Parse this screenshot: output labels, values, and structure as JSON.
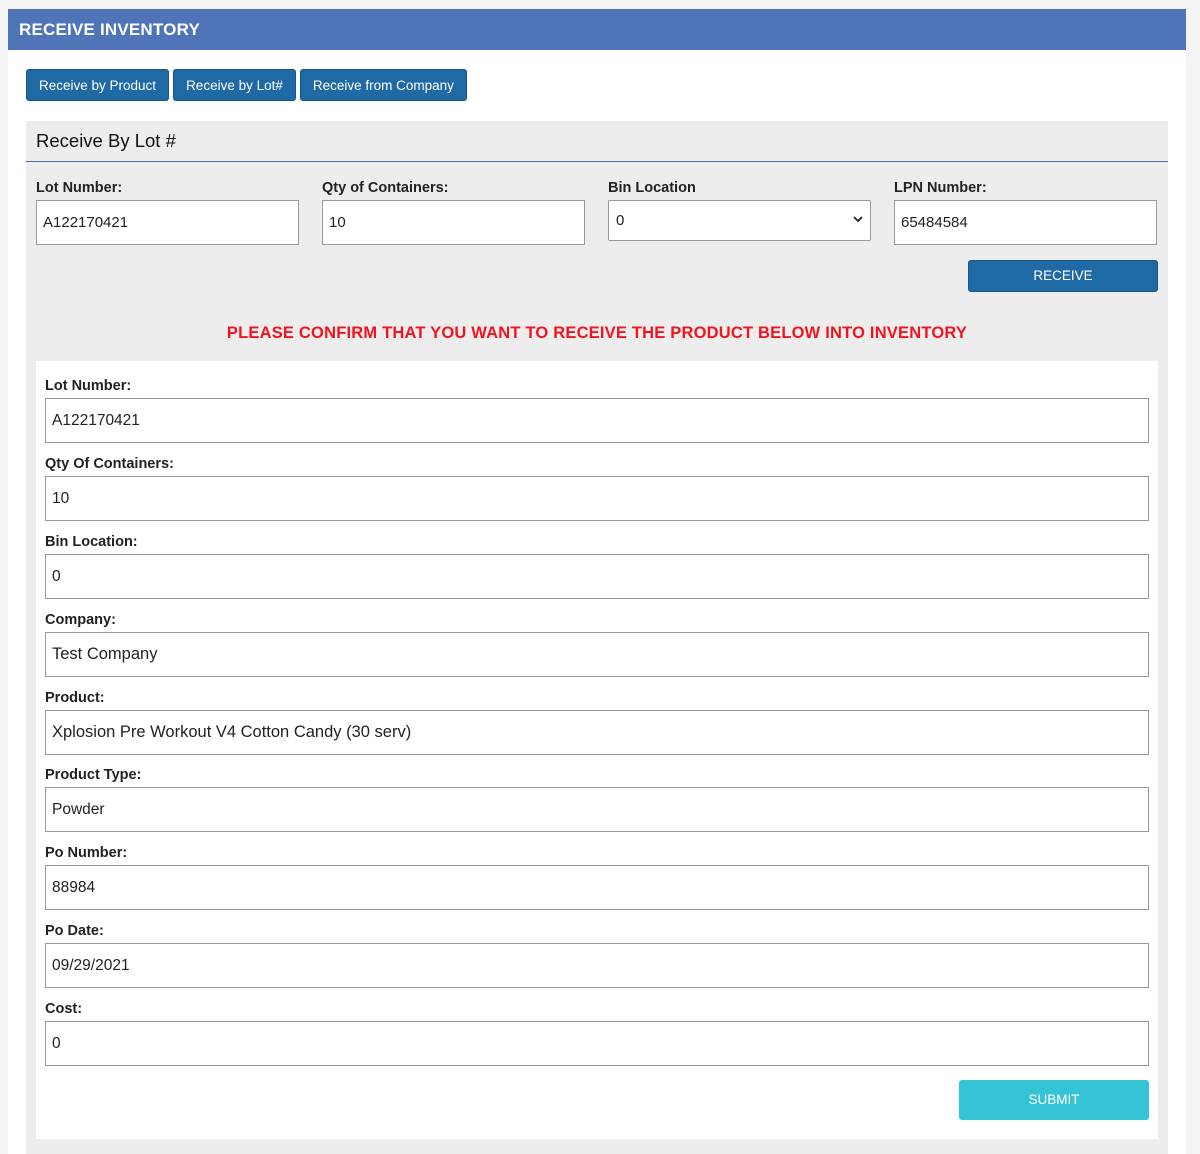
{
  "header": {
    "title": "RECEIVE INVENTORY"
  },
  "tabs": [
    {
      "label": "Receive by Product"
    },
    {
      "label": "Receive by Lot#"
    },
    {
      "label": "Receive from Company"
    }
  ],
  "panel": {
    "title": "Receive By Lot #",
    "form": {
      "lot_number": {
        "label": "Lot Number:",
        "value": "A122170421"
      },
      "qty_containers": {
        "label": "Qty of Containers:",
        "value": "10"
      },
      "bin_location": {
        "label": "Bin Location",
        "value": "0"
      },
      "lpn_number": {
        "label": "LPN Number:",
        "value": "65484584"
      }
    },
    "receive_label": "RECEIVE",
    "confirm_message": "PLEASE CONFIRM THAT YOU WANT TO RECEIVE THE PRODUCT BELOW INTO INVENTORY",
    "confirm_color": "#f0141e"
  },
  "confirm_form": {
    "fields": [
      {
        "label": "Lot Number:",
        "value": "A122170421"
      },
      {
        "label": "Qty Of Containers:",
        "value": "10"
      },
      {
        "label": "Bin Location:",
        "value": "0"
      },
      {
        "label": "Company:",
        "value": "Test Company"
      },
      {
        "label": "Product:",
        "value": "Xplosion Pre Workout V4 Cotton Candy (30 serv)"
      },
      {
        "label": "Product Type:",
        "value": "Powder"
      },
      {
        "label": "Po Number:",
        "value": "88984"
      },
      {
        "label": "Po Date:",
        "value": "09/29/2021"
      },
      {
        "label": "Cost:",
        "value": "0"
      }
    ],
    "submit_label": "SUBMIT"
  },
  "colors": {
    "header": "#5074b8",
    "primary_button": "#1f6aa5",
    "submit_button": "#35c4d6"
  }
}
